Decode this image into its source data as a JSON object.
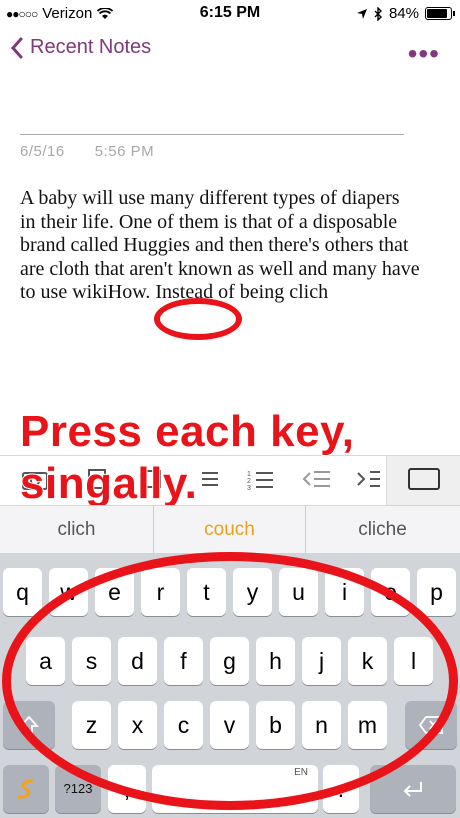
{
  "status": {
    "carrier": "Verizon",
    "time": "6:15 PM",
    "battery": "84%",
    "signal_icon": "signal-dots-icon",
    "wifi_icon": "wifi-icon"
  },
  "nav": {
    "back_label": "Recent Notes",
    "more_label": "•••"
  },
  "note": {
    "date": "6/5/16",
    "time": "5:56 PM",
    "body": "A baby will use many different types of diapers in their life. One of them is that of a disposable brand called Huggies and then there's others that are cloth that aren't known as well and many have to use wikiHow. Instead of being clich"
  },
  "annotation": {
    "text_line1": "Press each key,",
    "text_line2": "singally."
  },
  "suggestions": [
    "clich",
    "couch",
    "cliche"
  ],
  "keyboard": {
    "row1": [
      "q",
      "w",
      "e",
      "r",
      "t",
      "y",
      "u",
      "i",
      "o",
      "p"
    ],
    "row2": [
      "a",
      "s",
      "d",
      "f",
      "g",
      "h",
      "j",
      "k",
      "l"
    ],
    "row3": [
      "z",
      "x",
      "c",
      "v",
      "b",
      "n",
      "m"
    ],
    "numbers_label": "?123",
    "space_label": "EN",
    "comma": ",",
    "period": "."
  },
  "colors": {
    "accent": "#80397b",
    "annotation_red": "#e8141a",
    "suggestion_highlight": "#e8a11a"
  }
}
